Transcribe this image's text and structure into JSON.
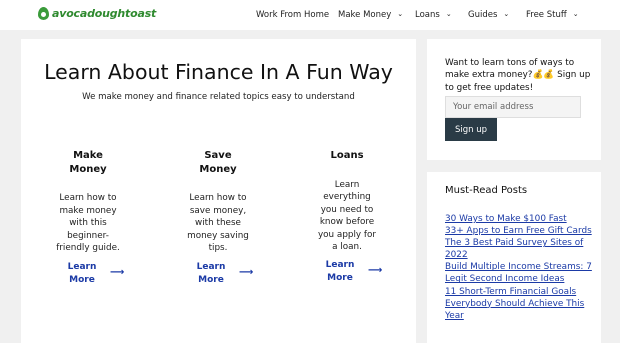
{
  "site": {
    "logo_text": "avocadoughtoast",
    "brand_color": "#3a9b3a"
  },
  "nav": {
    "items": [
      {
        "label": "Work From Home",
        "has_dropdown": false
      },
      {
        "label": "Make Money",
        "has_dropdown": true
      },
      {
        "label": "Loans",
        "has_dropdown": true
      },
      {
        "label": "Guides",
        "has_dropdown": true
      },
      {
        "label": "Free Stuff",
        "has_dropdown": true
      }
    ]
  },
  "hero": {
    "title": "Learn About Finance In A Fun Way",
    "subtitle": "We make money and finance related topics easy to understand"
  },
  "columns": [
    {
      "title": "Make Money",
      "description": "Learn how to make money with this beginner-friendly guide.",
      "link_label": "Learn More"
    },
    {
      "title": "Save Money",
      "description": "Learn how to save money, with these money saving tips.",
      "link_label": "Learn More"
    },
    {
      "title": "Loans",
      "description": "Learn everything you need to know before you apply for a loan.",
      "link_label": "Learn More"
    }
  ],
  "signup": {
    "text": "Want to learn tons of ways to make extra money?💰💰 Sign up to get free updates!",
    "email_placeholder": "Your email address",
    "button_label": "Sign up",
    "button_color": "#2a3b46"
  },
  "must_read": {
    "title": "Must-Read Posts",
    "posts": [
      "30 Ways to Make $100 Fast",
      "33+ Apps to Earn Free Gift Cards",
      "The 3 Best Paid Survey Sites of 2022",
      "Build Multiple Income Streams: 7 Legit Second Income Ideas",
      "11 Short-Term Financial Goals Everybody Should Achieve This Year"
    ]
  },
  "colors": {
    "link": "#1b3aa6",
    "page_background": "#f0f0f0"
  }
}
